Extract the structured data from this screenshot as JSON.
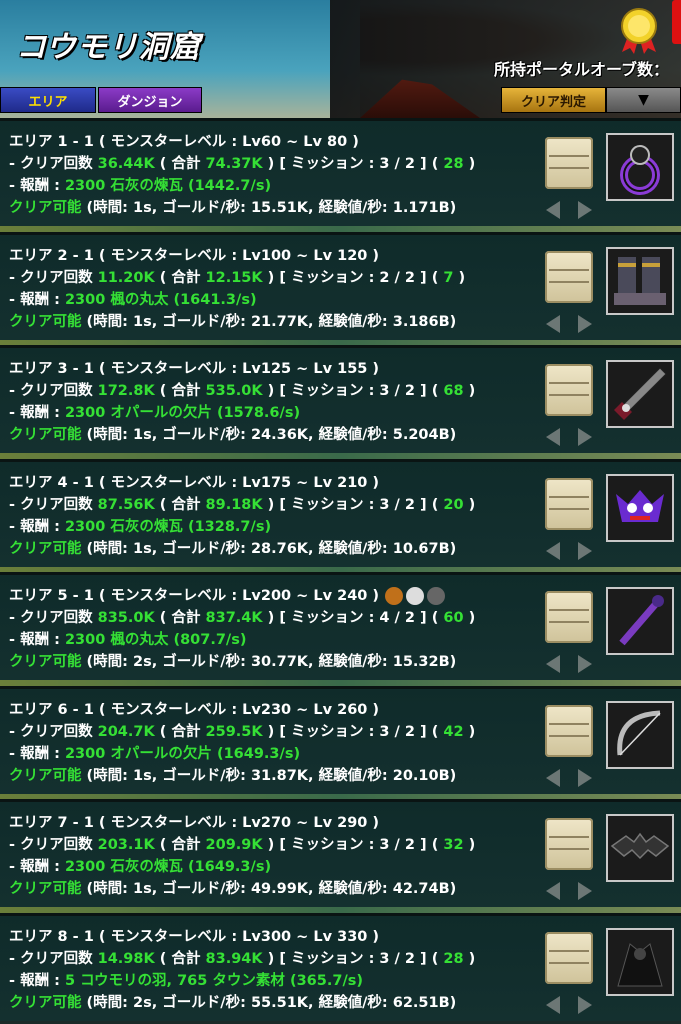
{
  "header": {
    "title": "コウモリ洞窟",
    "orb_label": "所持ポータルオーブ数：",
    "tabs": {
      "area": "エリア",
      "dungeon": "ダンジョン"
    },
    "clear_check_label": "クリア判定",
    "dropdown_symbol": "▼"
  },
  "rows": [
    {
      "title": "エリア 1 - 1 ( モンスターレベル : Lv60 ~ Lv 80 )",
      "clear_prefix": "- クリア回数 ",
      "clear_count": "36.44K",
      "total_prefix": " ( 合計 ",
      "total": "74.37K",
      "mission_text": " ) [ ミッション : 3 / 2 ] ( ",
      "mission_value": "28",
      "close": " )",
      "reward_prefix": "- 報酬 : ",
      "reward": "2300 石灰の煉瓦",
      "reward_rate": "(1442.7/s)",
      "clearable": "クリア可能",
      "stats": " (時間: 1s, ゴールド/秒: 15.51K, 経験値/秒: 1.171B)"
    },
    {
      "title": "エリア 2 - 1 ( モンスターレベル : Lv100 ~ Lv 120 )",
      "clear_prefix": "- クリア回数 ",
      "clear_count": "11.20K",
      "total_prefix": " ( 合計 ",
      "total": "12.15K",
      "mission_text": " ) [ ミッション : 2 / 2 ] ( ",
      "mission_value": "7",
      "close": " )",
      "reward_prefix": "- 報酬 : ",
      "reward": "2300 楓の丸太",
      "reward_rate": "(1641.3/s)",
      "clearable": "クリア可能",
      "stats": " (時間: 1s, ゴールド/秒: 21.77K, 経験値/秒: 3.186B)"
    },
    {
      "title": "エリア 3 - 1 ( モンスターレベル : Lv125 ~ Lv 155 )",
      "clear_prefix": "- クリア回数 ",
      "clear_count": "172.8K",
      "total_prefix": " ( 合計 ",
      "total": "535.0K",
      "mission_text": " ) [ ミッション : 3 / 2 ] ( ",
      "mission_value": "68",
      "close": " )",
      "reward_prefix": "- 報酬 : ",
      "reward": "2300 オパールの欠片",
      "reward_rate": "(1578.6/s)",
      "clearable": "クリア可能",
      "stats": " (時間: 1s, ゴールド/秒: 24.36K, 経験値/秒: 5.204B)"
    },
    {
      "title": "エリア 4 - 1 ( モンスターレベル : Lv175 ~ Lv 210 )",
      "clear_prefix": "- クリア回数 ",
      "clear_count": "87.56K",
      "total_prefix": " ( 合計 ",
      "total": "89.18K",
      "mission_text": " ) [ ミッション : 3 / 2 ] ( ",
      "mission_value": "20",
      "close": " )",
      "reward_prefix": "- 報酬 : ",
      "reward": "2300 石灰の煉瓦",
      "reward_rate": "(1328.7/s)",
      "clearable": "クリア可能",
      "stats": " (時間: 1s, ゴールド/秒: 28.76K, 経験値/秒: 10.67B)"
    },
    {
      "title": "エリア 5 - 1 ( モンスターレベル : Lv200 ~ Lv 240 )",
      "clear_prefix": "- クリア回数 ",
      "clear_count": "835.0K",
      "total_prefix": " ( 合計 ",
      "total": "837.4K",
      "mission_text": " ) [ ミッション : 4 / 2 ] ( ",
      "mission_value": "60",
      "close": " )",
      "reward_prefix": "- 報酬 : ",
      "reward": "2300 楓の丸太",
      "reward_rate": "(807.7/s)",
      "clearable": "クリア可能",
      "stats": " (時間: 2s, ゴールド/秒: 30.77K, 経験値/秒: 15.32B)"
    },
    {
      "title": "エリア 6 - 1 ( モンスターレベル : Lv230 ~ Lv 260 )",
      "clear_prefix": "- クリア回数 ",
      "clear_count": "204.7K",
      "total_prefix": " ( 合計 ",
      "total": "259.5K",
      "mission_text": " ) [ ミッション : 3 / 2 ] ( ",
      "mission_value": "42",
      "close": " )",
      "reward_prefix": "- 報酬 : ",
      "reward": "2300 オパールの欠片",
      "reward_rate": "(1649.3/s)",
      "clearable": "クリア可能",
      "stats": " (時間: 1s, ゴールド/秒: 31.87K, 経験値/秒: 20.10B)"
    },
    {
      "title": "エリア 7 - 1 ( モンスターレベル : Lv270 ~ Lv 290 )",
      "clear_prefix": "- クリア回数 ",
      "clear_count": "203.1K",
      "total_prefix": " ( 合計 ",
      "total": "209.9K",
      "mission_text": " ) [ ミッション : 3 / 2 ] ( ",
      "mission_value": "32",
      "close": " )",
      "reward_prefix": "- 報酬 : ",
      "reward": "2300 石灰の煉瓦",
      "reward_rate": "(1649.3/s)",
      "clearable": "クリア可能",
      "stats": " (時間: 1s, ゴールド/秒: 49.99K, 経験値/秒: 42.74B)"
    },
    {
      "title": "エリア 8 - 1 ( モンスターレベル : Lv300 ~ Lv 330 )",
      "clear_prefix": "- クリア回数 ",
      "clear_count": "14.98K",
      "total_prefix": " ( 合計 ",
      "total": "83.94K",
      "mission_text": " ) [ ミッション : 3 / 2 ] ( ",
      "mission_value": "28",
      "close": " )",
      "reward_prefix": "- 報酬 : ",
      "reward": "5 コウモリの羽, 765 タウン素材",
      "reward_rate": "(365.7/s)",
      "clearable": "クリア可能",
      "stats": " (時間: 2s, ゴールド/秒: 55.51K, 経験値/秒: 62.51B)"
    }
  ],
  "colors": {
    "highlight_green": "#35e035",
    "text_white": "#ffffff",
    "tab_yellow": "#ffe000"
  }
}
